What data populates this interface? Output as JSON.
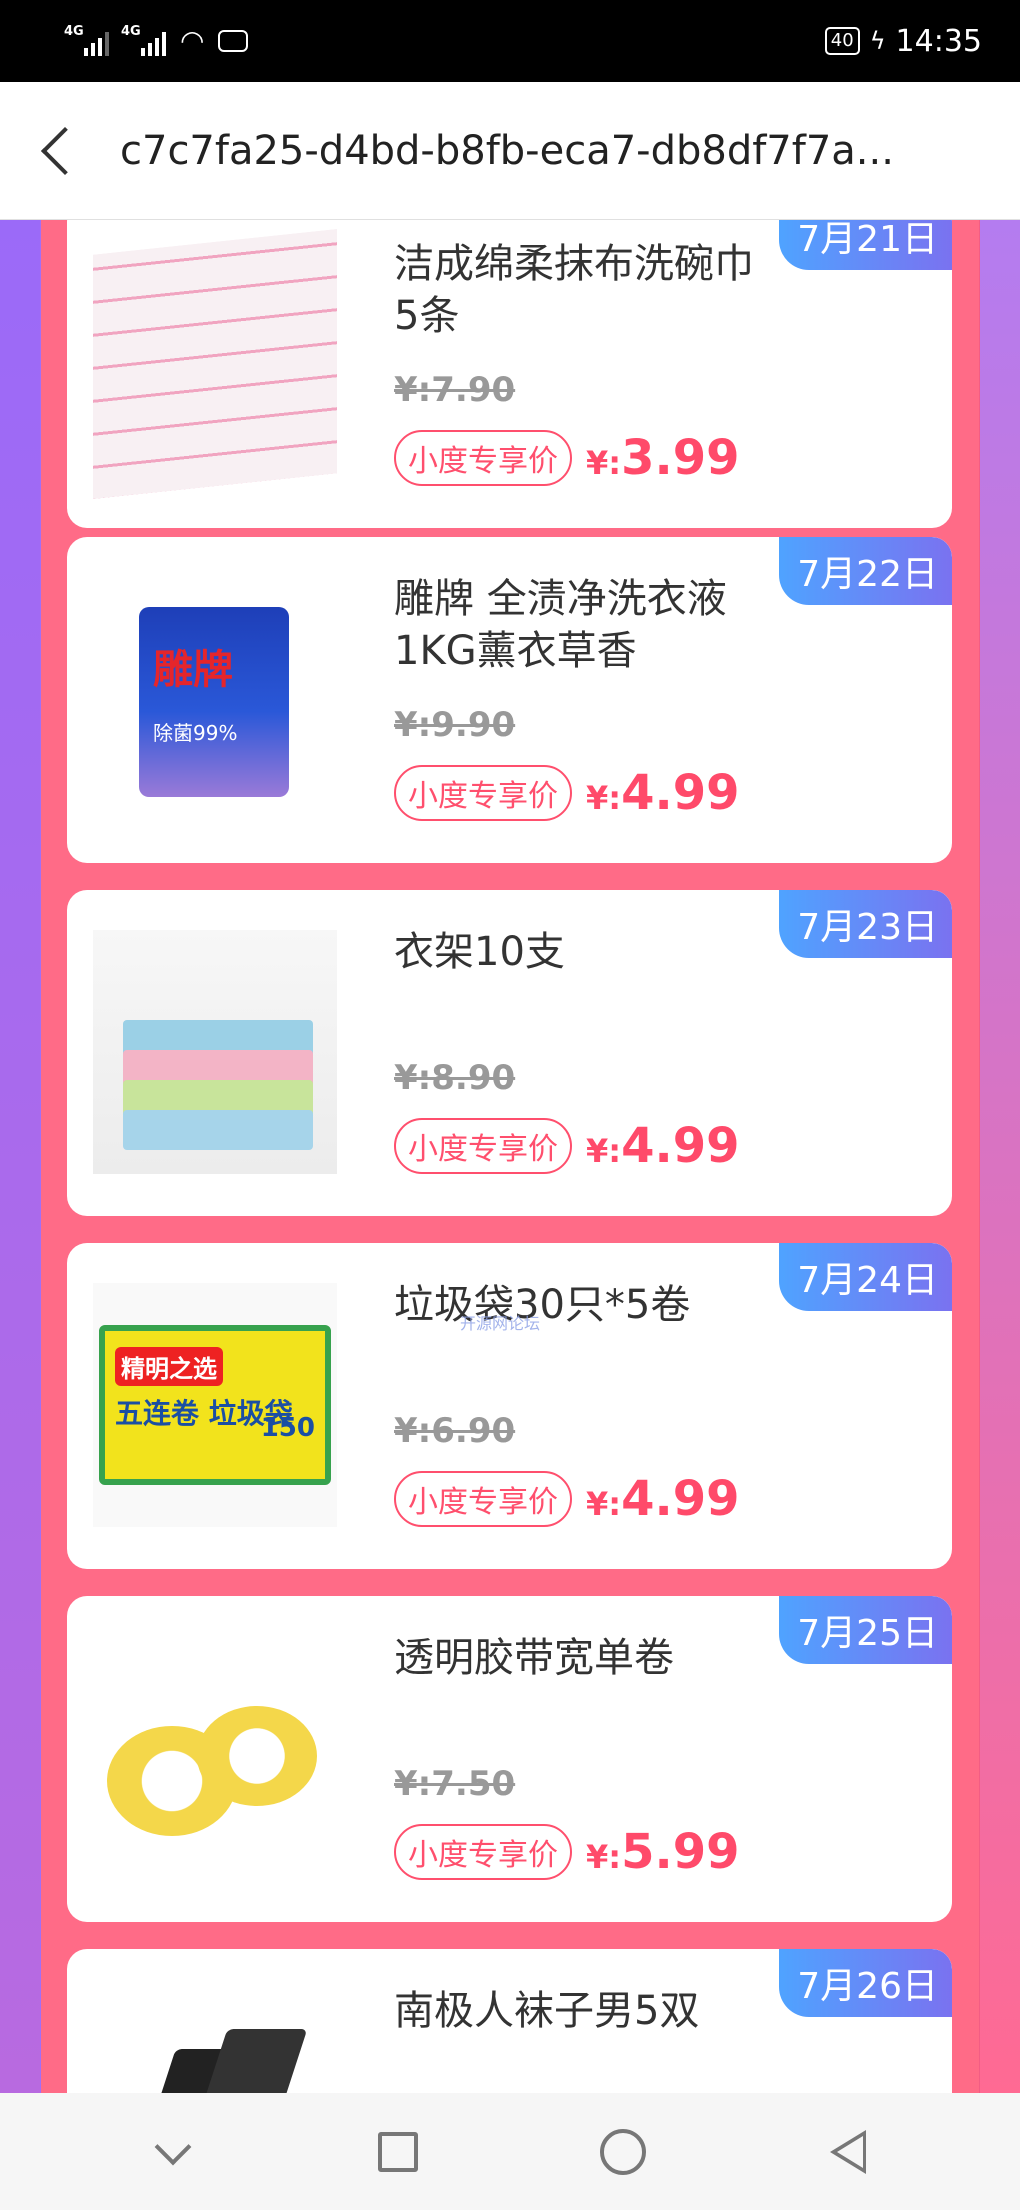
{
  "status": {
    "network1": "4G",
    "network2": "4G",
    "battery": "40",
    "time": "14:35"
  },
  "titlebar": {
    "title": "c7c7fa25-d4bd-b8fb-eca7-db8df7f7a..."
  },
  "products": [
    {
      "name": "洁成绵柔抹布洗碗巾5条",
      "date": "7月21日",
      "orig": "¥:7.90",
      "badge": "小度专享价",
      "yen": "¥:",
      "price": "3.99"
    },
    {
      "name": "雕牌 全渍净洗衣液1KG薰衣草香",
      "date": "7月22日",
      "orig": "¥:9.90",
      "badge": "小度专享价",
      "yen": "¥:",
      "price": "4.99"
    },
    {
      "name": "衣架10支",
      "date": "7月23日",
      "orig": "¥:8.90",
      "badge": "小度专享价",
      "yen": "¥:",
      "price": "4.99"
    },
    {
      "name": "垃圾袋30只*5卷",
      "date": "7月24日",
      "orig": "¥:6.90",
      "badge": "小度专享价",
      "yen": "¥:",
      "price": "4.99"
    },
    {
      "name": "透明胶带宽单卷",
      "date": "7月25日",
      "orig": "¥:7.50",
      "badge": "小度专享价",
      "yen": "¥:",
      "price": "5.99"
    },
    {
      "name": "南极人袜子男5双",
      "date": "7月26日"
    }
  ],
  "thumb_text": {
    "detergent_brand": "雕牌",
    "detergent_sub": "除菌99%",
    "bag_brand": "精明之选",
    "bag_line": "五连卷 垃圾袋",
    "bag_count": "150"
  },
  "watermark": "开源网论坛",
  "colors": {
    "accent_price": "#ff4a6a",
    "date_tag_start": "#4fa3ff",
    "date_tag_end": "#7a72f0",
    "page_bg": "#ff6b87"
  }
}
